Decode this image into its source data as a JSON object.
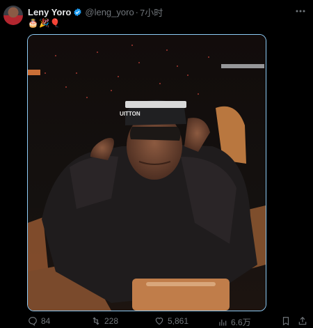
{
  "tweet": {
    "display_name": "Leny Yoro",
    "handle": "@leng_yoro",
    "separator": "·",
    "time": "7小时",
    "emojis": "🎂🎉🎈"
  },
  "photo_text": {
    "hat_brand": "UITTON"
  },
  "actions": {
    "replies": "84",
    "retweets": "228",
    "likes": "5,861",
    "views": "6.6万"
  },
  "colors": {
    "background": "#000000",
    "verified": "#1d9bf0",
    "media_border": "#8ecdf8",
    "secondary_text": "#71767b"
  }
}
